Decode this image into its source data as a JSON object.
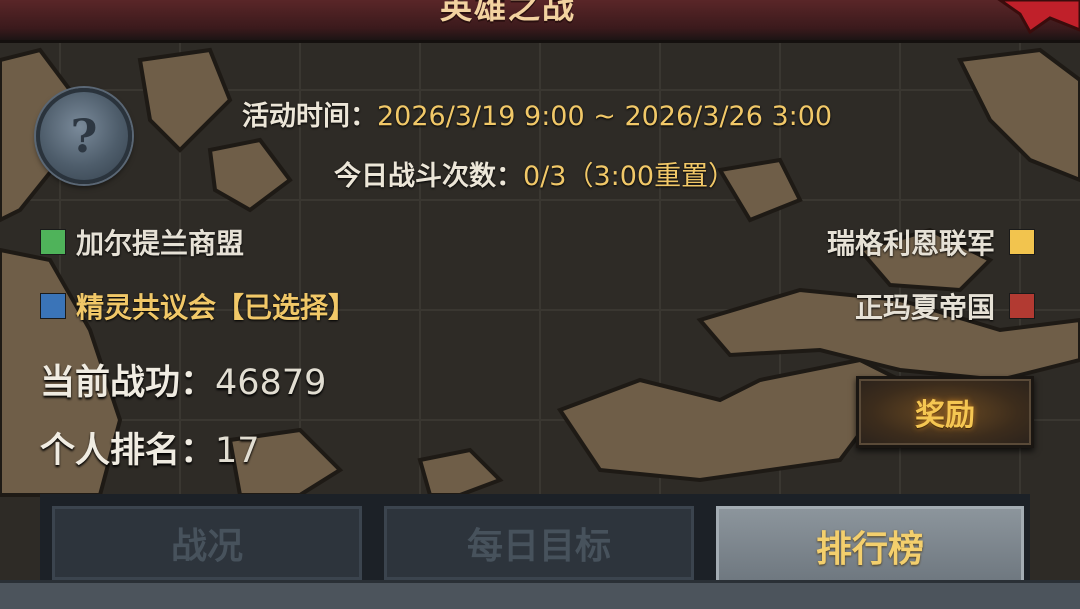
{
  "header": {
    "title": "英雄之战"
  },
  "event": {
    "time_label": "活动时间：",
    "time_value": "2026/3/19 9:00 ~ 2026/3/26 3:00",
    "battles_label": "今日战斗次数：",
    "battles_value": "0/3（3:00重置）"
  },
  "help": {
    "glyph": "?"
  },
  "factions": [
    {
      "name": "加尔提兰商盟",
      "color": "#4fb35a"
    },
    {
      "name": "精灵共议会",
      "selected_tag": "【已选择】",
      "color": "#3a74b8"
    },
    {
      "name": "瑞格利恩联军",
      "color": "#f2c44e"
    },
    {
      "name": "正玛夏帝国",
      "color": "#b23a32"
    }
  ],
  "stats": {
    "merit_label": "当前战功：",
    "merit_value": "46879",
    "rank_label": "个人排名：",
    "rank_value": "17"
  },
  "reward_button": {
    "label": "奖励"
  },
  "tabs": [
    {
      "label": "战况",
      "active": false
    },
    {
      "label": "每日目标",
      "active": false
    },
    {
      "label": "排行榜",
      "active": true
    }
  ],
  "colors": {
    "accent_gold": "#f1c868",
    "panel_dark": "#1c2127",
    "banner_red": "#5a2628"
  }
}
